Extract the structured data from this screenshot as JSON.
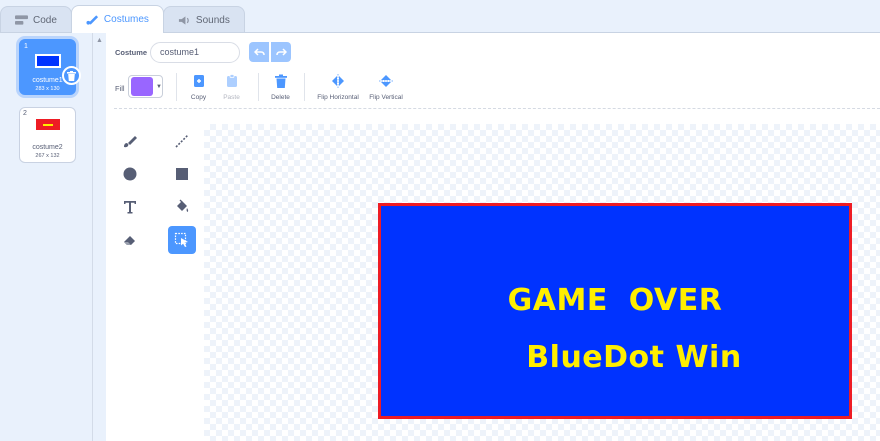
{
  "tabs": [
    {
      "label": "Code",
      "icon": "code-icon",
      "active": false
    },
    {
      "label": "Costumes",
      "icon": "brush-icon",
      "active": true
    },
    {
      "label": "Sounds",
      "icon": "speaker-icon",
      "active": false
    }
  ],
  "costumes": [
    {
      "number": "1",
      "name": "costume1",
      "size": "283 x 130",
      "thumb_color": "#0033ff",
      "selected": true
    },
    {
      "number": "2",
      "name": "costume2",
      "size": "267 x 132",
      "thumb_color": "#ee1c24",
      "selected": false
    }
  ],
  "editor": {
    "costume_label": "Costume",
    "costume_name": "costume1",
    "fill_label": "Fill",
    "fill_color": "#9966ff",
    "toolbar": {
      "copy": "Copy",
      "paste": "Paste",
      "delete": "Delete",
      "flip_horizontal": "Flip Horizontal",
      "flip_vertical": "Flip Vertical"
    },
    "paint_tools": [
      {
        "name": "brush-tool",
        "icon": "brush-icon"
      },
      {
        "name": "line-tool",
        "icon": "line-icon"
      },
      {
        "name": "circle-tool",
        "icon": "circle-icon"
      },
      {
        "name": "rectangle-tool",
        "icon": "rectangle-icon"
      },
      {
        "name": "text-tool",
        "icon": "text-icon"
      },
      {
        "name": "fill-tool",
        "icon": "bucket-icon"
      },
      {
        "name": "eraser-tool",
        "icon": "eraser-icon"
      },
      {
        "name": "select-tool",
        "icon": "select-icon",
        "active": true
      }
    ]
  },
  "canvas": {
    "art_line1": "GAME  OVER",
    "art_line2": "BlueDot Win",
    "art_bg_color": "#0033ff",
    "art_border_color": "#ee1c24",
    "art_text_color": "#ffee00"
  },
  "colors": {
    "accent": "#4c97ff",
    "text": "#575e75"
  }
}
